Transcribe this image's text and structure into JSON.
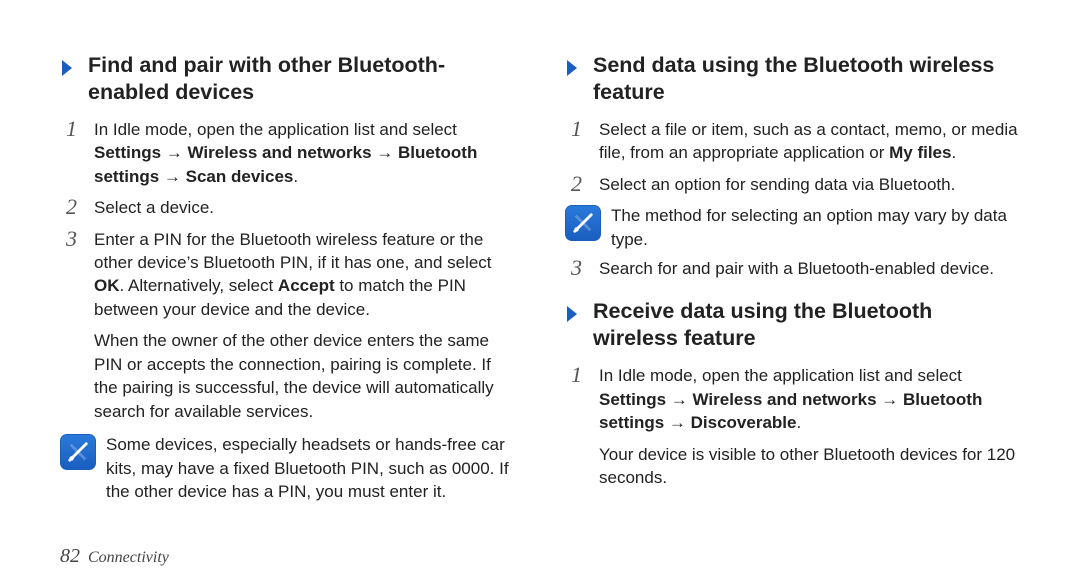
{
  "left": {
    "heading": "Find and pair with other Bluetooth-enabled devices",
    "step1_a": "In Idle mode, open the application list and select ",
    "step1_b": "Settings → Wireless and networks → Bluetooth settings → Scan devices",
    "step1_c": ".",
    "step2": "Select a device.",
    "step3_a": "Enter a PIN for the Bluetooth wireless feature or the other device’s Bluetooth PIN, if it has one, and select ",
    "step3_b": "OK",
    "step3_c": ". Alternatively, select ",
    "step3_d": "Accept",
    "step3_e": " to match the PIN between your device and the device.",
    "step3_tail": "When the owner of the other device enters the same PIN or accepts the connection, pairing is complete. If the pairing is successful, the device will automatically search for available services.",
    "note": "Some devices, especially headsets or hands-free car kits, may have a fixed Bluetooth PIN, such as 0000. If the other device has a PIN, you must enter it."
  },
  "rightA": {
    "heading": "Send data using the Bluetooth wireless feature",
    "step1_a": "Select a file or item, such as a contact, memo, or media file, from an appropriate application or ",
    "step1_b": "My files",
    "step1_c": ".",
    "step2": "Select an option for sending data via Bluetooth.",
    "note": "The method for selecting an option may vary by data type.",
    "step3": "Search for and pair with a Bluetooth-enabled device."
  },
  "rightB": {
    "heading": "Receive data using the Bluetooth wireless feature",
    "step1_a": "In Idle mode, open the application list and select ",
    "step1_b": "Settings → Wireless and networks → Bluetooth settings → Discoverable",
    "step1_c": ".",
    "step1_tail": "Your device is visible to other Bluetooth devices for 120 seconds."
  },
  "footer": {
    "page": "82",
    "section": "Connectivity"
  }
}
